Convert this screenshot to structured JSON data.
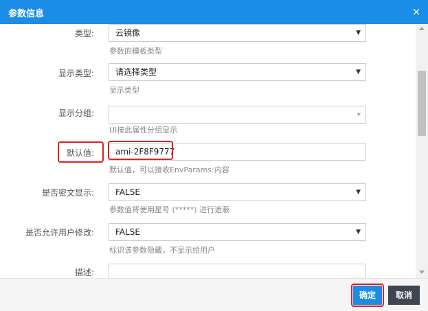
{
  "dialog": {
    "title": "参数信息",
    "close_glyph": "×",
    "close_icon": "close-icon"
  },
  "form": {
    "type": {
      "label": "类型:",
      "value": "云镜像",
      "hint": "参数的模板类型"
    },
    "display_type": {
      "label": "显示类型:",
      "value": "请选择类型",
      "hint": "显示类型"
    },
    "display_group": {
      "label": "显示分组:",
      "value": "",
      "hint": "UI按此属性分组显示"
    },
    "default_value": {
      "label": "默认值:",
      "value": "ami-2F8F9777",
      "hint": "默认值，可以接收EnvParams:内容"
    },
    "cipher_display": {
      "label": "是否密文显示:",
      "value": "FALSE",
      "hint": "参数值将使用星号 (*****) 进行遮蔽"
    },
    "allow_user_edit": {
      "label": "是否允许用户修改:",
      "value": "FALSE",
      "hint": "标识该参数隐藏，不显示给用户"
    },
    "description": {
      "label": "描述:",
      "value": ""
    },
    "dropdown_arrow": "▼"
  },
  "footer": {
    "confirm_label": "确定",
    "cancel_label": "取消"
  },
  "colors": {
    "titlebar": "#1a8ee6",
    "confirm_button": "#1a8ee6",
    "cancel_button": "#3d4651",
    "highlight": "#e02020"
  }
}
